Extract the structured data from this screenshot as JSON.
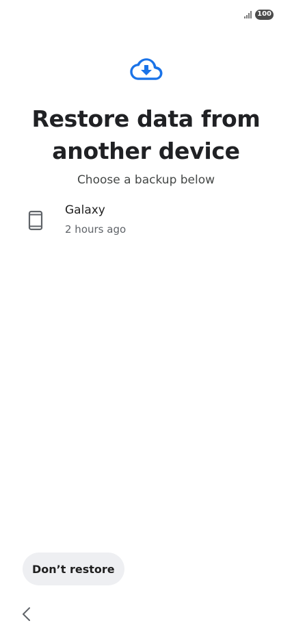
{
  "status_bar": {
    "battery_level": "100",
    "signal_icon": "signal-bars-icon"
  },
  "header": {
    "icon": "cloud-download-icon",
    "icon_color": "#1a73e8",
    "title": "Restore data from another device",
    "subtitle": "Choose a backup below"
  },
  "backups": [
    {
      "icon": "phone-icon",
      "name": "Galaxy",
      "time": "2 hours ago"
    }
  ],
  "actions": {
    "dont_restore_label": "Don’t restore"
  },
  "navigation": {
    "back_icon": "back-chevron-icon"
  }
}
